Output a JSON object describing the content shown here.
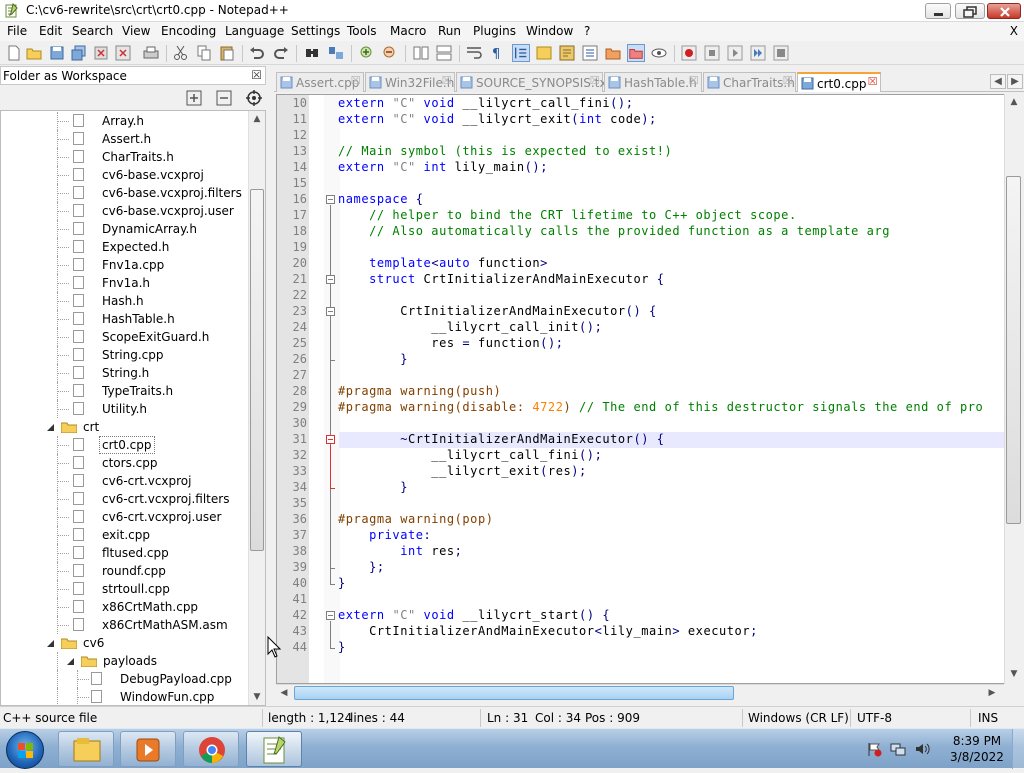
{
  "window": {
    "title": "C:\\cv6-rewrite\\src\\crt\\crt0.cpp - Notepad++"
  },
  "menu": [
    "File",
    "Edit",
    "Search",
    "View",
    "Encoding",
    "Language",
    "Settings",
    "Tools",
    "Macro",
    "Run",
    "Plugins",
    "Window",
    "?"
  ],
  "menu_close": "X",
  "panel": {
    "title": "Folder as Workspace",
    "close": "☒",
    "tree": [
      {
        "label": "Array.h",
        "kind": "file",
        "depth": 3
      },
      {
        "label": "Assert.h",
        "kind": "file",
        "depth": 3
      },
      {
        "label": "CharTraits.h",
        "kind": "file",
        "depth": 3
      },
      {
        "label": "cv6-base.vcxproj",
        "kind": "file",
        "depth": 3
      },
      {
        "label": "cv6-base.vcxproj.filters",
        "kind": "file",
        "depth": 3
      },
      {
        "label": "cv6-base.vcxproj.user",
        "kind": "file",
        "depth": 3
      },
      {
        "label": "DynamicArray.h",
        "kind": "file",
        "depth": 3
      },
      {
        "label": "Expected.h",
        "kind": "file",
        "depth": 3
      },
      {
        "label": "Fnv1a.cpp",
        "kind": "file",
        "depth": 3
      },
      {
        "label": "Fnv1a.h",
        "kind": "file",
        "depth": 3
      },
      {
        "label": "Hash.h",
        "kind": "file",
        "depth": 3
      },
      {
        "label": "HashTable.h",
        "kind": "file",
        "depth": 3
      },
      {
        "label": "ScopeExitGuard.h",
        "kind": "file",
        "depth": 3
      },
      {
        "label": "String.cpp",
        "kind": "file",
        "depth": 3
      },
      {
        "label": "String.h",
        "kind": "file",
        "depth": 3
      },
      {
        "label": "TypeTraits.h",
        "kind": "file",
        "depth": 3
      },
      {
        "label": "Utility.h",
        "kind": "file",
        "depth": 3
      },
      {
        "label": "crt",
        "kind": "folder",
        "depth": 2
      },
      {
        "label": "crt0.cpp",
        "kind": "file",
        "depth": 3,
        "selected": true
      },
      {
        "label": "ctors.cpp",
        "kind": "file",
        "depth": 3
      },
      {
        "label": "cv6-crt.vcxproj",
        "kind": "file",
        "depth": 3
      },
      {
        "label": "cv6-crt.vcxproj.filters",
        "kind": "file",
        "depth": 3
      },
      {
        "label": "cv6-crt.vcxproj.user",
        "kind": "file",
        "depth": 3
      },
      {
        "label": "exit.cpp",
        "kind": "file",
        "depth": 3
      },
      {
        "label": "fltused.cpp",
        "kind": "file",
        "depth": 3
      },
      {
        "label": "roundf.cpp",
        "kind": "file",
        "depth": 3
      },
      {
        "label": "strtoull.cpp",
        "kind": "file",
        "depth": 3
      },
      {
        "label": "x86CrtMath.cpp",
        "kind": "file",
        "depth": 3
      },
      {
        "label": "x86CrtMathASM.asm",
        "kind": "file",
        "depth": 3
      },
      {
        "label": "cv6",
        "kind": "folder",
        "depth": 2
      },
      {
        "label": "payloads",
        "kind": "folder",
        "depth": 3
      },
      {
        "label": "DebugPayload.cpp",
        "kind": "file",
        "depth": 4
      },
      {
        "label": "WindowFun.cpp",
        "kind": "file",
        "depth": 4
      }
    ]
  },
  "tabs": [
    {
      "label": "Assert.cpp",
      "active": false
    },
    {
      "label": "Win32File.h",
      "active": false
    },
    {
      "label": "SOURCE_SYNOPSIS.txt",
      "active": false
    },
    {
      "label": "HashTable.h",
      "active": false
    },
    {
      "label": "CharTraits.h",
      "active": false
    },
    {
      "label": "crt0.cpp",
      "active": true
    }
  ],
  "code": {
    "first_line": 10,
    "current_line": 31,
    "lines": [
      [
        [
          "kw",
          "extern "
        ],
        [
          "st",
          "\"C\" "
        ],
        [
          "kw",
          "void "
        ],
        [
          "t",
          "__lilycrt_call_fini"
        ],
        [
          "op",
          "();"
        ]
      ],
      [
        [
          "kw",
          "extern "
        ],
        [
          "st",
          "\"C\" "
        ],
        [
          "kw",
          "void "
        ],
        [
          "t",
          "__lilycrt_exit"
        ],
        [
          "op",
          "("
        ],
        [
          "kw",
          "int "
        ],
        [
          "t",
          "code"
        ],
        [
          "op",
          ");"
        ]
      ],
      [],
      [
        [
          "cm",
          "// Main symbol (this is expected to exist!)"
        ]
      ],
      [
        [
          "kw",
          "extern "
        ],
        [
          "st",
          "\"C\" "
        ],
        [
          "kw",
          "int "
        ],
        [
          "t",
          "lily_main"
        ],
        [
          "op",
          "();"
        ]
      ],
      [],
      [
        [
          "kw",
          "namespace "
        ],
        [
          "op",
          "{"
        ]
      ],
      [
        [
          "t",
          "    "
        ],
        [
          "cm",
          "// helper to bind the CRT lifetime to C++ object scope."
        ]
      ],
      [
        [
          "t",
          "    "
        ],
        [
          "cm",
          "// Also automatically calls the provided function as a template arg"
        ]
      ],
      [],
      [
        [
          "t",
          "    "
        ],
        [
          "kw",
          "template"
        ],
        [
          "op",
          "<"
        ],
        [
          "kw",
          "auto "
        ],
        [
          "t",
          "function"
        ],
        [
          "op",
          ">"
        ]
      ],
      [
        [
          "t",
          "    "
        ],
        [
          "kw",
          "struct "
        ],
        [
          "t",
          "CrtInitializerAndMainExecutor "
        ],
        [
          "op",
          "{"
        ]
      ],
      [],
      [
        [
          "t",
          "        CrtInitializerAndMainExecutor"
        ],
        [
          "op",
          "() {"
        ]
      ],
      [
        [
          "t",
          "            __lilycrt_call_init"
        ],
        [
          "op",
          "();"
        ]
      ],
      [
        [
          "t",
          "            res "
        ],
        [
          "op",
          "= "
        ],
        [
          "t",
          "function"
        ],
        [
          "op",
          "();"
        ]
      ],
      [
        [
          "t",
          "        "
        ],
        [
          "op",
          "}"
        ]
      ],
      [],
      [
        [
          "pp",
          "#pragma warning(push)"
        ]
      ],
      [
        [
          "pp",
          "#pragma warning(disable: "
        ],
        [
          "nm",
          "4722"
        ],
        [
          "pp",
          ") "
        ],
        [
          "cm",
          "// The end of this destructor signals the end of pro"
        ]
      ],
      [],
      [
        [
          "t",
          "        "
        ],
        [
          "op",
          "~"
        ],
        [
          "t",
          "CrtInitializerAndMainExecutor"
        ],
        [
          "op",
          "() {"
        ]
      ],
      [
        [
          "t",
          "            __lilycrt_call_fini"
        ],
        [
          "op",
          "();"
        ]
      ],
      [
        [
          "t",
          "            __lilycrt_exit"
        ],
        [
          "op",
          "("
        ],
        [
          "t",
          "res"
        ],
        [
          "op",
          ");"
        ]
      ],
      [
        [
          "t",
          "        "
        ],
        [
          "op",
          "}"
        ]
      ],
      [],
      [
        [
          "pp",
          "#pragma warning(pop)"
        ]
      ],
      [
        [
          "t",
          "    "
        ],
        [
          "kw",
          "private"
        ],
        [
          "op",
          ":"
        ]
      ],
      [
        [
          "t",
          "        "
        ],
        [
          "kw",
          "int "
        ],
        [
          "t",
          "res"
        ],
        [
          "op",
          ";"
        ]
      ],
      [
        [
          "t",
          "    "
        ],
        [
          "op",
          "};"
        ]
      ],
      [
        [
          "op",
          "}"
        ]
      ],
      [],
      [
        [
          "kw",
          "extern "
        ],
        [
          "st",
          "\"C\" "
        ],
        [
          "kw",
          "void "
        ],
        [
          "t",
          "__lilycrt_start"
        ],
        [
          "op",
          "() {"
        ]
      ],
      [
        [
          "t",
          "    CrtInitializerAndMainExecutor"
        ],
        [
          "op",
          "<"
        ],
        [
          "t",
          "lily_main"
        ],
        [
          "op",
          "> "
        ],
        [
          "t",
          "executor"
        ],
        [
          "op",
          ";"
        ]
      ],
      [
        [
          "op",
          "}"
        ]
      ]
    ]
  },
  "status": {
    "language": "C++ source file",
    "length": "length : 1,124",
    "lines": "lines : 44",
    "ln": "Ln : 31",
    "col": "Col : 34",
    "pos": "Pos : 909",
    "eol": "Windows (CR LF)",
    "encoding": "UTF-8",
    "mode": "INS"
  },
  "taskbar": {
    "time": "8:39 PM",
    "date": "3/8/2022"
  },
  "colors": {
    "accent_tab": "#f3a637",
    "selection": "#e8e8ff",
    "keyword": "#0000ff",
    "comment": "#008000",
    "preprocessor": "#804000"
  }
}
